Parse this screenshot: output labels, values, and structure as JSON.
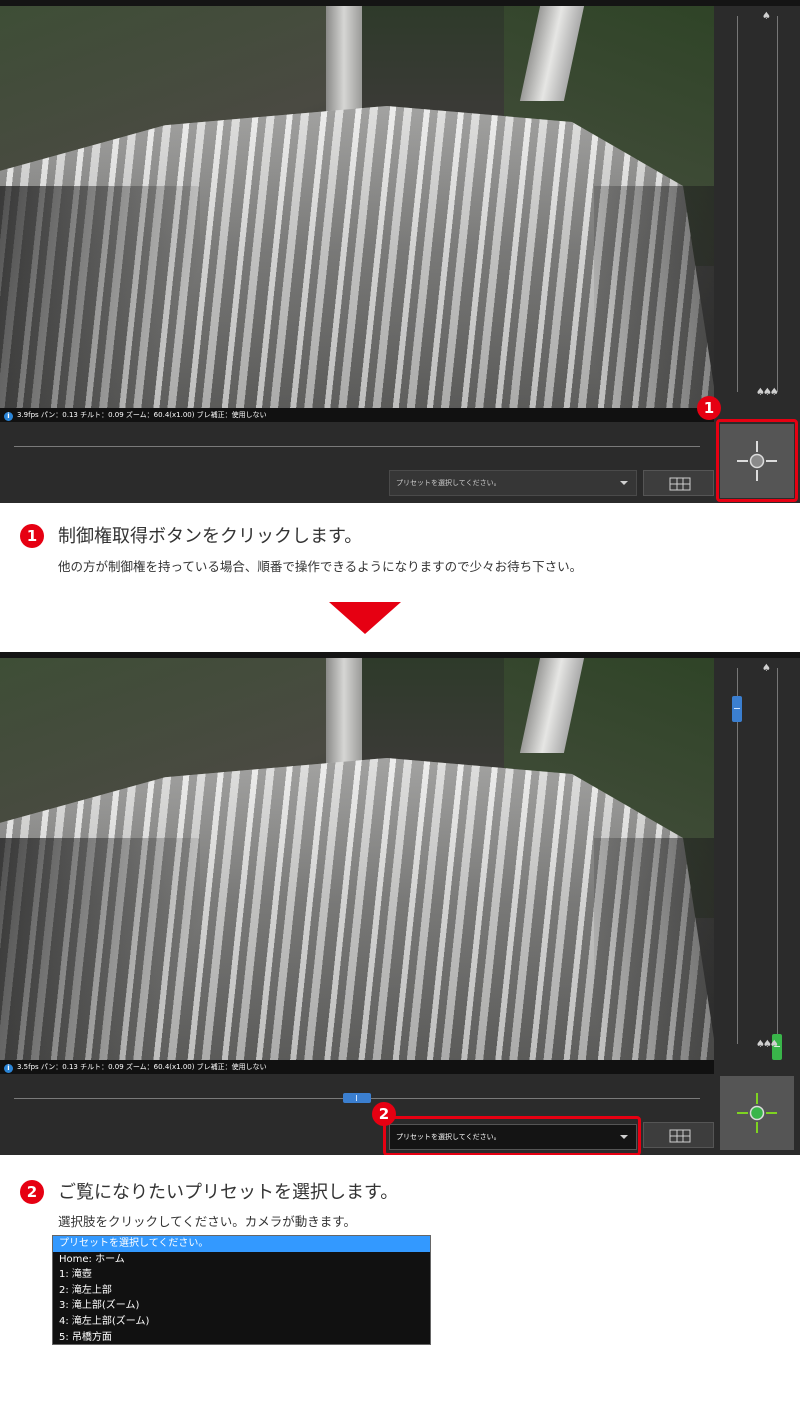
{
  "viewer_status": {
    "fps": "3.9fps",
    "text": "パン：0.13 チルト：0.09 ズーム：60.4(x1.00) ブレ補正：使用しない"
  },
  "viewer_status_2": {
    "fps": "3.5fps",
    "text": "パン：0.13 チルト：0.09 ズーム：60.4(x1.00) ブレ補正：使用しない"
  },
  "preset_select": {
    "placeholder": "プリセットを選択してください。"
  },
  "step1": {
    "number": "1",
    "title": "制御権取得ボタンをクリックします。",
    "subtitle": "他の方が制御権を持っている場合、順番で操作できるようになりますので少々お待ち下さい。"
  },
  "step2": {
    "number": "2",
    "title": "ご覧になりたいプリセットを選択します。",
    "subtitle": "選択肢をクリックしてください。カメラが動きます。"
  },
  "preset_options": [
    "プリセットを選択してください。",
    "Home: ホーム",
    "1: 滝壺",
    "2: 滝左上部",
    "3: 滝上部(ズーム)",
    "4: 滝左上部(ズーム)",
    "5: 吊橋方面"
  ],
  "colors": {
    "accent_red": "#e60012",
    "ptz_blue": "#3b7fd0",
    "focus_green": "#39b54a",
    "control_idle": "#cccccc",
    "control_active": "#7ed321",
    "selected_option": "#3399ff"
  },
  "icons": {
    "control_button": "crosshair-icon",
    "grid_button": "grid-icon",
    "zoom_tele": "single-tree-icon",
    "zoom_wide": "tree-group-icon",
    "info": "info-icon"
  },
  "state": {
    "panel1_has_control": false,
    "panel2_has_control": true
  }
}
